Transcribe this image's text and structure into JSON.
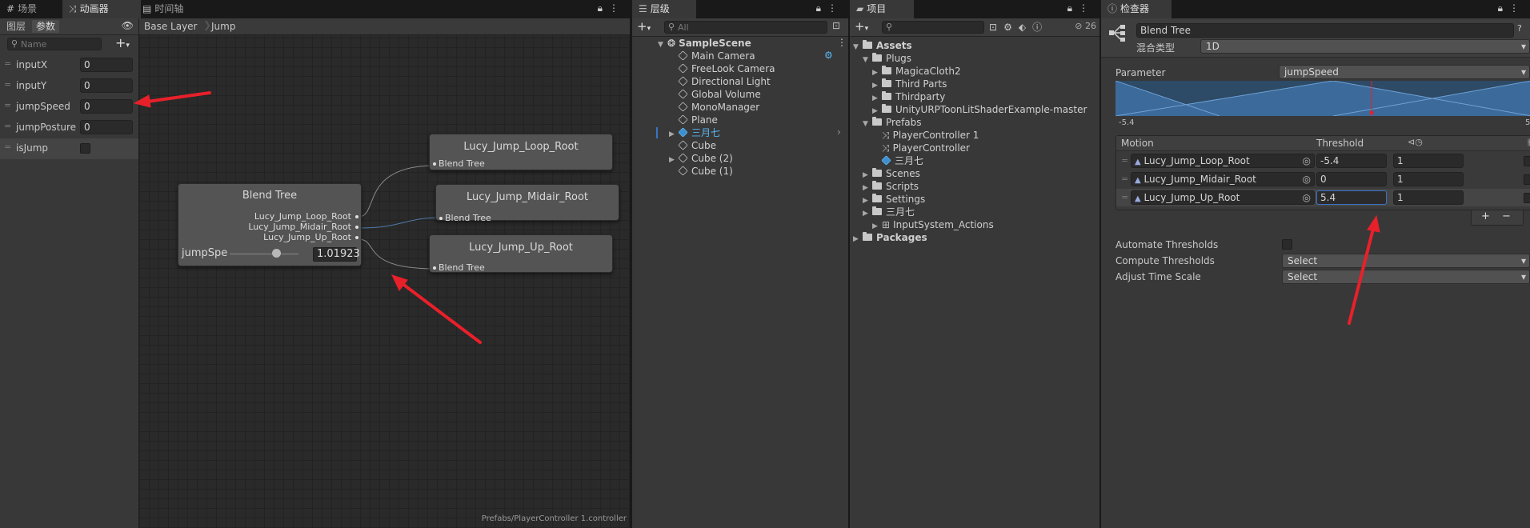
{
  "animator_panel": {
    "tabs": [
      {
        "label": "场景",
        "icon": "grid-icon"
      },
      {
        "label": "动画器",
        "icon": "animator-icon"
      },
      {
        "label": "时间轴",
        "icon": "timeline-icon"
      }
    ],
    "sub_tabs": [
      "图层",
      "参数"
    ],
    "search_placeholder": "Name",
    "breadcrumb": [
      "Base Layer",
      "Jump"
    ],
    "parameters": [
      {
        "name": "inputX",
        "value": "0"
      },
      {
        "name": "inputY",
        "value": "0"
      },
      {
        "name": "jumpSpeed",
        "value": "0"
      },
      {
        "name": "jumpPosture",
        "value": "0"
      },
      {
        "name": "isJump",
        "value": "",
        "is_bool": true
      }
    ],
    "blend_tree_node": {
      "title": "Blend Tree",
      "ports": [
        "Lucy_Jump_Loop_Root",
        "Lucy_Jump_Midair_Root",
        "Lucy_Jump_Up_Root"
      ],
      "param_label": "jumpSpe",
      "param_value": "1.01923"
    },
    "child_nodes": [
      {
        "title": "Lucy_Jump_Loop_Root",
        "sub": "Blend Tree"
      },
      {
        "title": "Lucy_Jump_Midair_Root",
        "sub": "Blend Tree"
      },
      {
        "title": "Lucy_Jump_Up_Root",
        "sub": "Blend Tree"
      }
    ],
    "status_path": "Prefabs/PlayerController 1.controller"
  },
  "hierarchy_panel": {
    "tab_label": "层级",
    "search_placeholder": "All",
    "scene_name": "SampleScene",
    "items": [
      {
        "label": "Main Camera"
      },
      {
        "label": "FreeLook Camera"
      },
      {
        "label": "Directional Light"
      },
      {
        "label": "Global Volume"
      },
      {
        "label": "MonoManager"
      },
      {
        "label": "Plane"
      },
      {
        "label": "三月七"
      },
      {
        "label": "Cube"
      },
      {
        "label": "Cube (2)"
      },
      {
        "label": "Cube (1)"
      }
    ]
  },
  "project_panel": {
    "tab_label": "项目",
    "hidden_count": "26",
    "tree": [
      {
        "label": "Assets"
      },
      {
        "label": "Plugs"
      },
      {
        "label": "MagicaCloth2"
      },
      {
        "label": "Third Parts"
      },
      {
        "label": "Thirdparty"
      },
      {
        "label": "UnityURPToonLitShaderExample-master"
      },
      {
        "label": "Prefabs"
      },
      {
        "label": "PlayerController 1"
      },
      {
        "label": "PlayerController"
      },
      {
        "label": "三月七"
      },
      {
        "label": "Scenes"
      },
      {
        "label": "Scripts"
      },
      {
        "label": "Settings"
      },
      {
        "label": "三月七"
      },
      {
        "label": "InputSystem_Actions"
      },
      {
        "label": "Packages"
      }
    ]
  },
  "inspector_panel": {
    "tab_label": "检查器",
    "object_name": "Blend Tree",
    "blend_type_label": "混合类型",
    "blend_type_value": "1D",
    "parameter_label": "Parameter",
    "parameter_value": "jumpSpeed",
    "range_min": "-5.4",
    "range_max": "5",
    "table_headers": {
      "motion": "Motion",
      "threshold": "Threshold"
    },
    "motions": [
      {
        "name": "Lucy_Jump_Loop_Root",
        "threshold": "-5.4",
        "speed": "1"
      },
      {
        "name": "Lucy_Jump_Midair_Root",
        "threshold": "0",
        "speed": "1"
      },
      {
        "name": "Lucy_Jump_Up_Root",
        "threshold": "5.4",
        "speed": "1"
      }
    ],
    "add_label": "+",
    "remove_label": "−",
    "automate_label": "Automate Thresholds",
    "compute_label": "Compute Thresholds",
    "compute_value": "Select",
    "adjust_label": "Adjust Time Scale",
    "adjust_value": "Select"
  },
  "colors": {
    "annotation_arrow": "#e8202a",
    "selected_field": "#3a72c4",
    "blend_graph": "#3c6a9a"
  }
}
